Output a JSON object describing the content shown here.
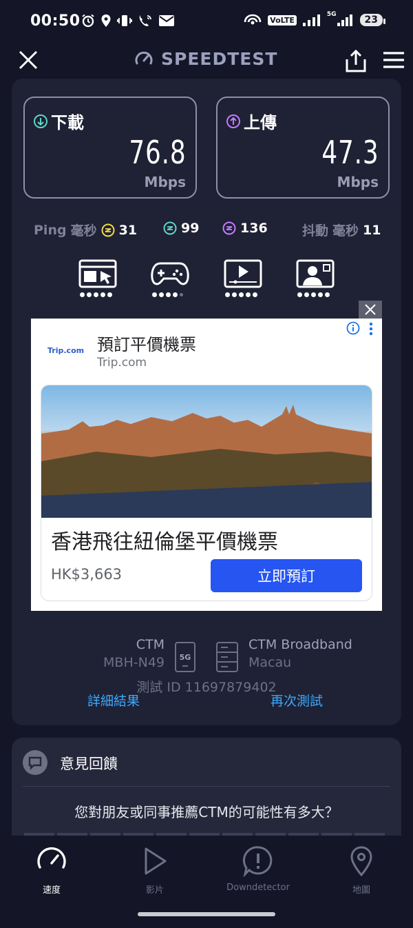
{
  "status_bar": {
    "time": "00:50",
    "network_label": "5G",
    "volte": "VoLTE",
    "battery": "23"
  },
  "header": {
    "brand": "SPEEDTEST"
  },
  "results": {
    "download": {
      "label": "下載",
      "value": "76.8",
      "unit": "Mbps"
    },
    "upload": {
      "label": "上傳",
      "value": "47.3",
      "unit": "Mbps"
    },
    "ping": {
      "label": "Ping",
      "unit_label": "毫秒",
      "idle": "31",
      "download": "99",
      "upload": "136"
    },
    "jitter": {
      "label": "抖動",
      "unit_label": "毫秒",
      "value": "11"
    },
    "usage_ratings": [
      5,
      4,
      5,
      5
    ]
  },
  "ad": {
    "advertiser_logo": "Trip.com",
    "title": "預訂平價機票",
    "domain": "Trip.com",
    "headline": "香港飛往紐倫堡平價機票",
    "price": "HK$3,663",
    "cta": "立即預訂"
  },
  "server": {
    "isp_name": "CTM",
    "device": "MBH-N49",
    "network_type": "5G",
    "host_name": "CTM Broadband",
    "host_city": "Macau",
    "test_id": "測試 ID 11697879402",
    "detail_link": "詳細結果",
    "retest_link": "再次測試"
  },
  "feedback": {
    "title": "意見回饋",
    "question": "您對朋友或同事推薦CTM的可能性有多大？"
  },
  "bottom_nav": {
    "speed": "速度",
    "video": "影片",
    "downdetector": "Downdetector",
    "map": "地圖"
  },
  "colors": {
    "background": "#141526",
    "card": "#1f2134",
    "download_accent": "#5fd6c6",
    "upload_accent": "#c47bff",
    "ping_idle": "#f2d84b",
    "link": "#3ba9ff",
    "ad_cta": "#2655f2"
  }
}
